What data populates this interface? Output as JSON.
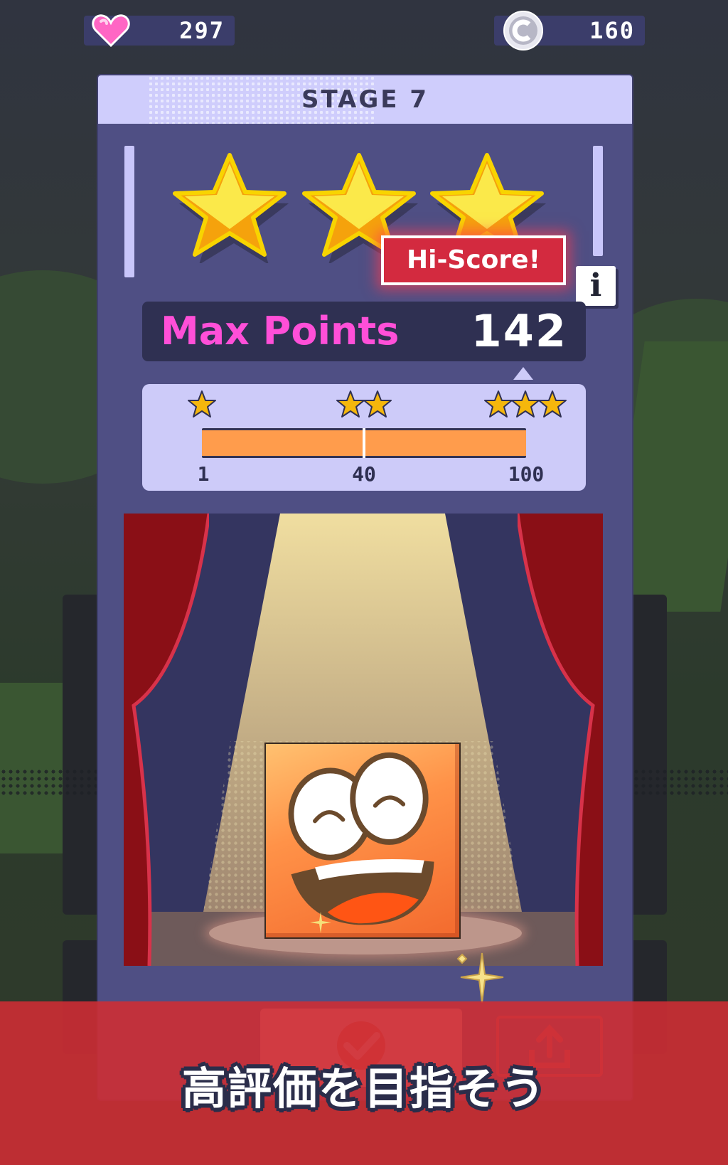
{
  "hud": {
    "lives": "297",
    "coins": "160",
    "lives_icon": "heart-icon",
    "coins_icon": "coin-icon"
  },
  "dialog": {
    "title": "STAGE 7",
    "stars_earned": 3,
    "stars_total": 3,
    "hiscore_badge": "Hi-Score!",
    "info_label": "i",
    "max_points_label": "Max Points",
    "max_points_value": "142",
    "thresholds": [
      {
        "stars": 1,
        "label": "1"
      },
      {
        "stars": 2,
        "label": "40"
      },
      {
        "stars": 3,
        "label": "100"
      }
    ],
    "progress_fraction": 1.0
  },
  "banner": {
    "text": "高評価を目指そう"
  },
  "buttons": {
    "confirm_icon": "checkmark-icon",
    "share_icon": "share-icon"
  },
  "colors": {
    "accent_pink": "#ff4fd8",
    "dialog_bg": "#4f4f84",
    "header_bg": "#cfcdfc",
    "progress_fill": "#ff9c4c",
    "banner_red": "#cd2d34",
    "hiscore_red": "#d32a3f"
  }
}
